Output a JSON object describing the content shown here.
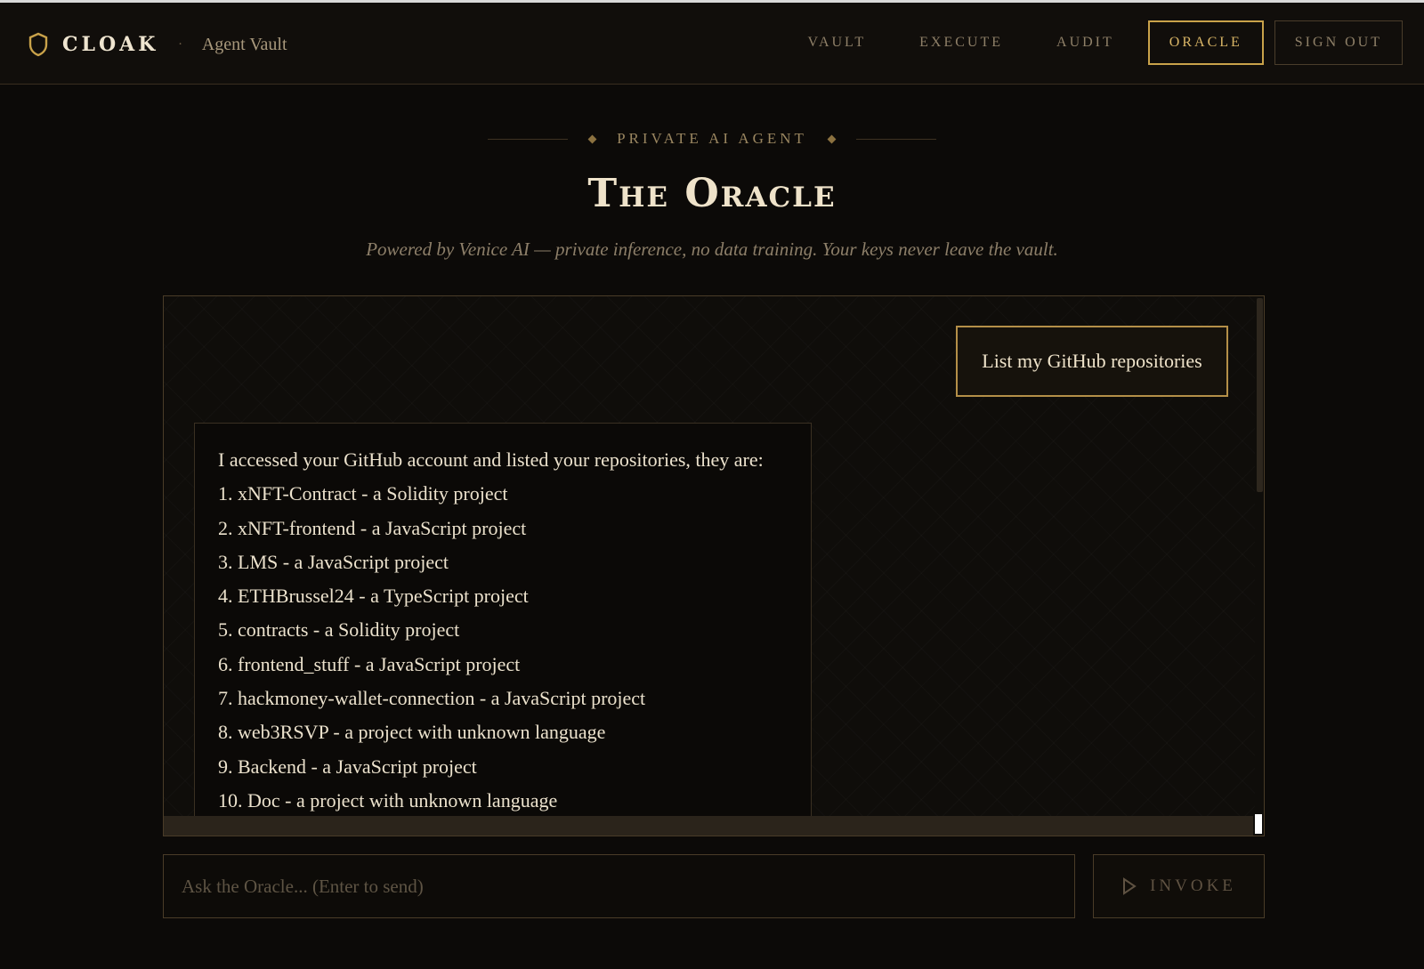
{
  "header": {
    "brand": "CLOAK",
    "separator": "·",
    "subtitle": "Agent Vault",
    "nav": {
      "vault": "VAULT",
      "execute": "EXECUTE",
      "audit": "AUDIT",
      "oracle": "ORACLE",
      "sign_out": "SIGN OUT"
    }
  },
  "hero": {
    "eyebrow": "PRIVATE AI AGENT",
    "title": "The Oracle",
    "subtitle": "Powered by Venice AI — private inference, no data training. Your keys never leave the vault."
  },
  "chat": {
    "user_message": "List my GitHub repositories",
    "assistant_lines": [
      "I accessed your GitHub account and listed your repositories, they are:",
      "1. xNFT-Contract - a Solidity project",
      "2. xNFT-frontend - a JavaScript project",
      "3. LMS - a JavaScript project",
      "4. ETHBrussel24 - a TypeScript project",
      "5. contracts - a Solidity project",
      "6. frontend_stuff - a JavaScript project",
      "7. hackmoney-wallet-connection - a JavaScript project",
      "8. web3RSVP - a project with unknown language",
      "9. Backend - a JavaScript project",
      "10. Doc - a project with unknown language"
    ]
  },
  "composer": {
    "placeholder": "Ask the Oracle... (Enter to send)",
    "value": "",
    "send_label": "INVOKE"
  },
  "icons": {
    "brand": "shield-icon",
    "send": "play-icon"
  },
  "colors": {
    "accent_gold": "#c9a24a",
    "background": "#0c0a08"
  }
}
